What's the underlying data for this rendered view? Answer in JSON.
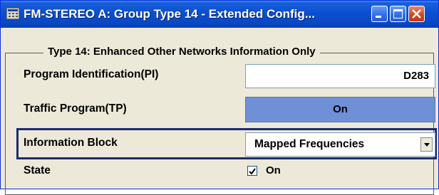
{
  "window": {
    "title": "FM-STEREO A: Group Type 14 - Extended Config...",
    "icon": "settings-window-icon",
    "buttons": [
      "minimize",
      "maximize",
      "close"
    ]
  },
  "group": {
    "legend": "Type 14: Enhanced Other Networks Information Only"
  },
  "fields": {
    "program_identification": {
      "label": "Program Identification(PI)",
      "value": "D283"
    },
    "traffic_program": {
      "label": "Traffic Program(TP)",
      "value": "On"
    },
    "information_block": {
      "label": "Information Block",
      "value": "Mapped Frequencies"
    },
    "state": {
      "label": "State",
      "checked": true,
      "value": "On"
    }
  },
  "colors": {
    "titlebar": "#0a48c4",
    "button_active": "#6f8fd6",
    "focus": "#1e2a70"
  }
}
